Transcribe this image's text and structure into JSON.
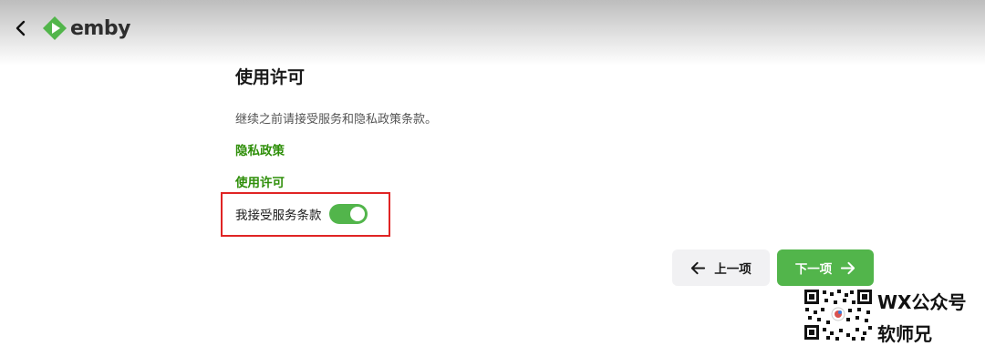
{
  "header": {
    "brand": "emby",
    "colors": {
      "brand_green": "#52b54b"
    },
    "icons": {
      "back": "chevron-left-icon",
      "logo": "emby-logo-icon"
    }
  },
  "main": {
    "title": "使用许可",
    "description": "继续之前请接受服务和隐私政策条款。",
    "links": {
      "privacy": "隐私政策",
      "license": "使用许可"
    },
    "accept": {
      "label": "我接受服务条款",
      "checked": true
    },
    "link_color": "#2f8f0a",
    "highlight_color": "#e02424"
  },
  "footer": {
    "prev_label": "上一项",
    "next_label": "下一项",
    "icons": {
      "prev": "arrow-left-icon",
      "next": "arrow-right-icon"
    }
  },
  "watermark": {
    "line1": "WX公众号",
    "line2": "软师兄",
    "icon": "qr-code-icon"
  }
}
